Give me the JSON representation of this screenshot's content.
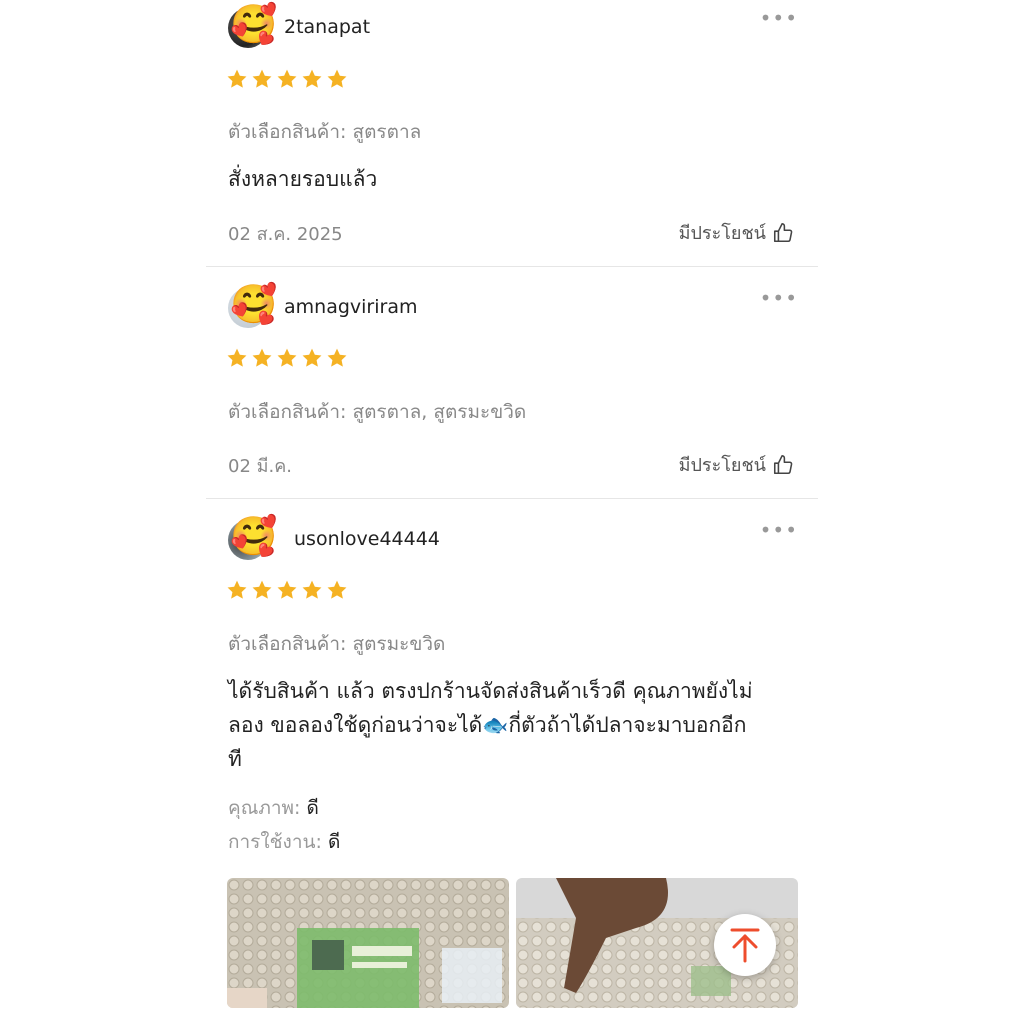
{
  "reviews": [
    {
      "username": "2tanapat",
      "rating": 5,
      "variant_label": "ตัวเลือกสินค้า:",
      "variant_value": "สูตรตาล",
      "comment": "สั่งหลายรอบแล้ว",
      "date": "02 ส.ค. 2025",
      "helpful_label": "มีประโยชน์"
    },
    {
      "username": "amnagviriram",
      "rating": 5,
      "variant_label": "ตัวเลือกสินค้า:",
      "variant_value": "สูตรตาล, สูตรมะขวิด",
      "date": "02 มี.ค.",
      "helpful_label": "มีประโยชน์"
    },
    {
      "username": "usonlove44444",
      "rating": 5,
      "variant_label": "ตัวเลือกสินค้า:",
      "variant_value": "สูตรมะขวิด",
      "comment_line1": "ได้รับสินค้า แล้ว ตรงปกร้านจัดส่งสินค้าเร็วดี คุณภาพยังไม่",
      "comment_line2_a": "ลอง ขอลองใช้ดูก่อนว่าจะได้",
      "comment_line2_b": "กี่ตัวถ้าได้ปลาจะมาบอกอีก",
      "comment_line3": "ที",
      "quality_label": "คุณภาพ:",
      "quality_value": "ดี",
      "usage_label": "การใช้งาน:",
      "usage_value": "ดี"
    }
  ],
  "icons": {
    "more": "more-icon",
    "like": "thumbs-up-icon",
    "star": "star-icon",
    "scroll_top": "arrow-up-icon",
    "fish": "fish-emoji"
  },
  "colors": {
    "star": "#f5b223",
    "accent": "#ee4d2d",
    "muted": "#888888"
  },
  "emoji": {
    "avatar_sticker": "🥰",
    "fish": "🐟"
  }
}
